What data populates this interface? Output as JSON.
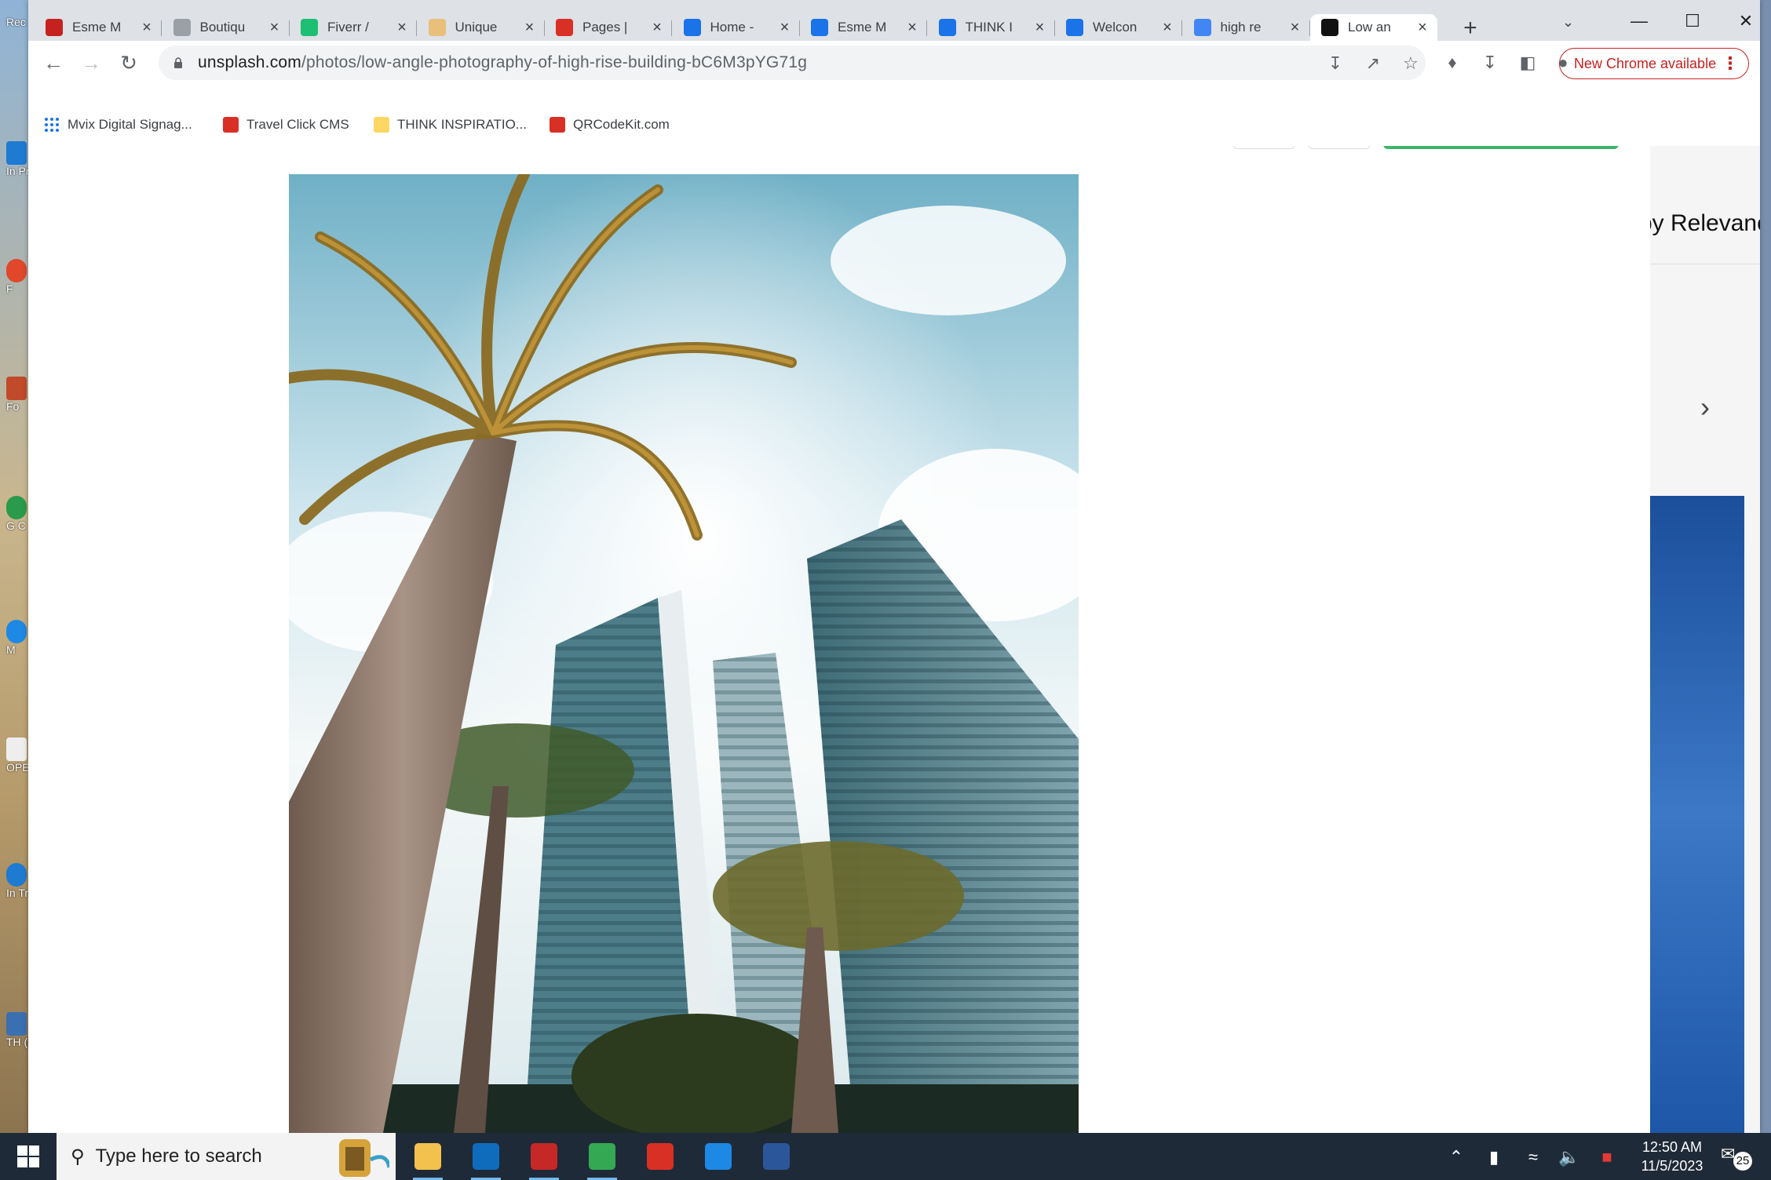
{
  "desktop": {
    "icons": [
      {
        "label": "Rec",
        "color": "#3a6fb0"
      },
      {
        "label": "In Pro",
        "color": "#1f7ad1"
      },
      {
        "label": "F",
        "color": "#e0472b"
      },
      {
        "label": "Fo",
        "color": "#c04a2a"
      },
      {
        "label": "G C",
        "color": "#2a9a4b"
      },
      {
        "label": "M",
        "color": "#1e88e5"
      },
      {
        "label": "OPE",
        "color": "#eeeeee"
      },
      {
        "label": "In Tr",
        "color": "#1f7ad1"
      },
      {
        "label": "TH (thg",
        "color": "#3a6fb0"
      }
    ]
  },
  "tabs": [
    {
      "title": "Esme M",
      "favicon": "pdf-icon",
      "color": "#c5221f"
    },
    {
      "title": "Boutiqu",
      "favicon": "page-icon",
      "color": "#9aa0a6"
    },
    {
      "title": "Fiverr /",
      "favicon": "fiverr-icon",
      "color": "#1dbf73"
    },
    {
      "title": "Unique",
      "favicon": "sparkle-icon",
      "color": "#e8c07a"
    },
    {
      "title": "Pages |",
      "favicon": "pages-icon",
      "color": "#d93025"
    },
    {
      "title": "Home -",
      "favicon": "c-icon",
      "color": "#1a73e8"
    },
    {
      "title": "Esme M",
      "favicon": "c-icon",
      "color": "#1a73e8"
    },
    {
      "title": "THINK I",
      "favicon": "c-icon",
      "color": "#1a73e8"
    },
    {
      "title": "Welcon",
      "favicon": "chat-icon",
      "color": "#1a73e8"
    },
    {
      "title": "high re",
      "favicon": "google-icon",
      "color": "#4285f4"
    },
    {
      "title": "Low an",
      "favicon": "unsplash-icon",
      "color": "#111111",
      "active": true
    }
  ],
  "toolbar": {
    "url_host": "unsplash.com",
    "url_path": "/photos/low-angle-photography-of-high-rise-building-bC6M3pYG71g",
    "update_label": "New Chrome available"
  },
  "bookmarks": [
    {
      "label": "Mvix Digital Signag...",
      "icon": "apps-grid-icon",
      "color": "#1a73e8"
    },
    {
      "label": "Travel Click CMS",
      "icon": "travelclick-icon",
      "color": "#d93025"
    },
    {
      "label": "THINK INSPIRATIO...",
      "icon": "folder-icon",
      "color": "#fdd663"
    },
    {
      "label": "QRCodeKit.com",
      "icon": "qrcode-icon",
      "color": "#d93025"
    }
  ],
  "page": {
    "behind_text": "by Relevanc",
    "photo_alt": "Low angle photography of high rise building"
  },
  "taskbar": {
    "search_placeholder": "Type here to search",
    "time": "12:50 AM",
    "date": "11/5/2023",
    "notification_count": "25",
    "apps": [
      {
        "name": "file-explorer",
        "color": "#f2c14e"
      },
      {
        "name": "outlook",
        "color": "#0f6cbd"
      },
      {
        "name": "antivirus",
        "color": "#c62828"
      },
      {
        "name": "chrome",
        "color": "#34a853"
      },
      {
        "name": "acrobat",
        "color": "#d93025"
      },
      {
        "name": "edge",
        "color": "#1e88e5"
      },
      {
        "name": "word",
        "color": "#2b579a"
      }
    ]
  }
}
